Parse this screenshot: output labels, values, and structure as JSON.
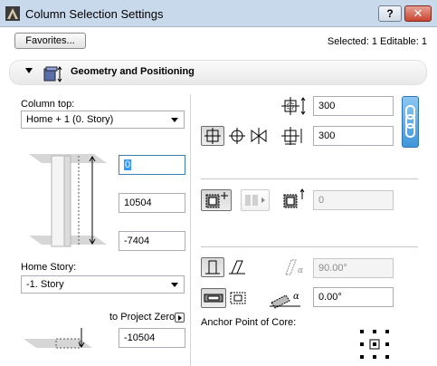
{
  "window": {
    "title": "Column Selection Settings",
    "help_label": "?",
    "close_label": "✕"
  },
  "toolbar": {
    "favorites_label": "Favorites...",
    "selection_info": "Selected: 1 Editable: 1"
  },
  "section": {
    "title": "Geometry and Positioning"
  },
  "left": {
    "column_top_label": "Column top:",
    "column_top_value": "Home + 1 (0. Story)",
    "top_offset_value": "0",
    "height_value": "10504",
    "bottom_offset_value": "-7404",
    "home_story_label": "Home Story:",
    "home_story_value": "-1. Story",
    "to_project_zero_label": "to Project Zero",
    "project_zero_value": "-10504"
  },
  "right": {
    "width_value": "300",
    "depth_value": "300",
    "veneer_value": "0",
    "angle_value": "90.00°",
    "rotation_value": "0.00°",
    "anchor_label": "Anchor Point of Core:"
  },
  "colors": {
    "titlebar": "#c9d9ec",
    "chain_button": "#3f97d9",
    "focus_border": "#3c7fb1"
  }
}
